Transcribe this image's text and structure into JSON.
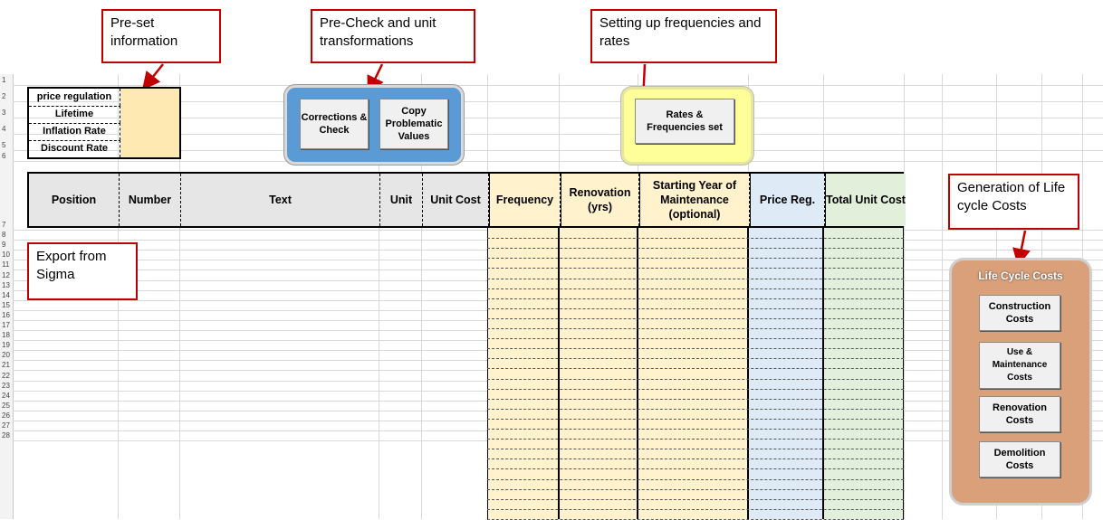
{
  "callouts": {
    "preset": "Pre-set information",
    "precheck": "Pre-Check and unit transformations",
    "frequencies": "Setting up frequencies and rates",
    "export": "Export from Sigma",
    "generation": "Generation of Life cycle Costs"
  },
  "row_numbers": [
    "1",
    "2",
    "3",
    "4",
    "5",
    "6",
    "7",
    "8",
    "9",
    "10",
    "11",
    "12",
    "13",
    "14",
    "15",
    "16",
    "17",
    "18",
    "19",
    "20",
    "21",
    "22",
    "23",
    "24",
    "25",
    "26",
    "27",
    "28"
  ],
  "preset_table": {
    "rows": [
      {
        "label": "price regulation",
        "value": ""
      },
      {
        "label": "Lifetime",
        "value": ""
      },
      {
        "label": "Inflation Rate",
        "value": ""
      },
      {
        "label": "Discount Rate",
        "value": ""
      }
    ]
  },
  "buttons": {
    "corrections_check": "Corrections & Check",
    "copy_problematic": "Copy Problematic Values",
    "rates_frequencies": "Rates & Frequencies set",
    "lcc_title": "Life Cycle Costs",
    "construction": "Construction Costs",
    "use_maintenance": "Use & Maintenance Costs",
    "renovation": "Renovation Costs",
    "demolition": "Demolition Costs"
  },
  "table": {
    "headers": [
      "Position",
      "Number",
      "Text",
      "Unit",
      "Unit Cost",
      "Frequency",
      "Renovation (yrs)",
      "Starting Year of Maintenance (optional)",
      "Price Reg.",
      "Total Unit Cost"
    ]
  },
  "colors": {
    "callout_border": "#c00000",
    "frequency_fill": "#fff2cc",
    "price_reg_fill": "#deebf7",
    "total_cost_fill": "#e2efda",
    "precheck_group": "#5b9bd5",
    "rates_group": "#ffff99",
    "lcc_group": "#d9a07a"
  }
}
